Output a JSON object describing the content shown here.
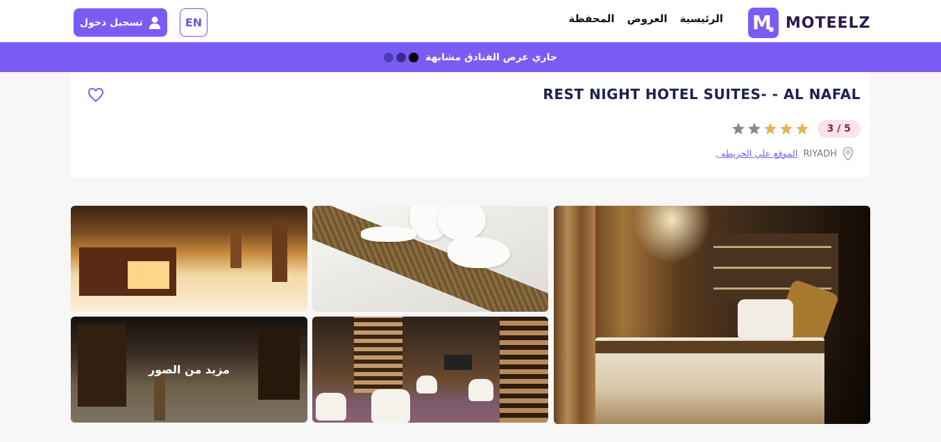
{
  "header": {
    "logo_text": "MOTEELZ",
    "logo_letter": "M",
    "nav": [
      {
        "label": "الرئيسية"
      },
      {
        "label": "العروض"
      },
      {
        "label": "المحفظة"
      }
    ],
    "lang_label": "EN",
    "login_label": "تسجيل دخول"
  },
  "banner": {
    "text": "جاري عرض الفنادق مشابهة",
    "color": "#7a5cf5"
  },
  "hotel": {
    "name": "REST NIGHT HOTEL SUITES- - AL NAFAL",
    "rating_text": "3 / 5",
    "stars_filled": 3,
    "stars_total": 5,
    "city": "RIYADH",
    "map_link": "الموقع علي الخريطه ,"
  },
  "gallery": {
    "more_photos_label": "مزيد من الصور",
    "photos": [
      "bedroom",
      "towel-swans",
      "lobby-reception",
      "lounge",
      "lobby-hall"
    ]
  },
  "colors": {
    "accent": "#7a5cf5",
    "star_filled": "#e0b458",
    "star_empty": "#8a8a8a",
    "badge_bg": "#fbe3ec",
    "badge_text": "#8a1d4a"
  }
}
